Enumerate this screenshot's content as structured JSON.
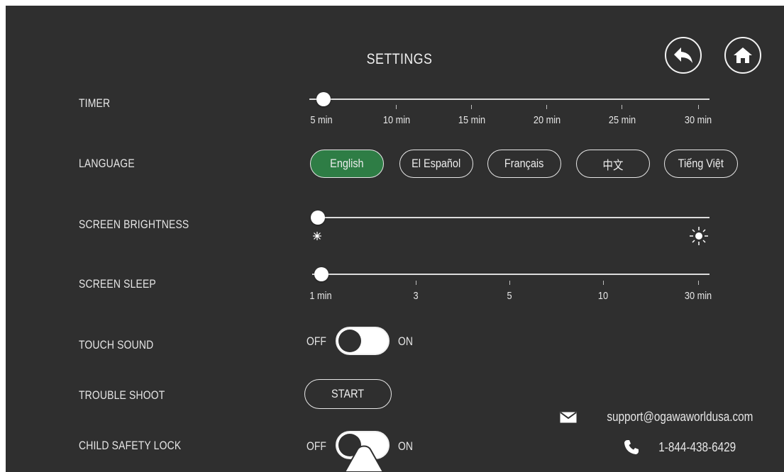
{
  "header": {
    "title": "SETTINGS"
  },
  "rows": {
    "timer": {
      "label": "TIMER",
      "ticks": [
        "5 min",
        "10 min",
        "15 min",
        "20 min",
        "25 min",
        "30 min"
      ],
      "value": "5 min"
    },
    "language": {
      "label": "LANGUAGE",
      "options": [
        "English",
        "El Español",
        "Français",
        "中文",
        "Tiếng Việt"
      ],
      "selected": "English"
    },
    "brightness": {
      "label": "SCREEN BRIGHTNESS",
      "level": 0
    },
    "sleep": {
      "label": "SCREEN SLEEP",
      "ticks": [
        "1 min",
        "3",
        "5",
        "10",
        "30 min"
      ],
      "value": "1 min"
    },
    "touch_sound": {
      "label": "TOUCH SOUND",
      "off": "OFF",
      "on": "ON",
      "state": "OFF"
    },
    "trouble_shoot": {
      "label": "TROUBLE SHOOT",
      "button": "START"
    },
    "child_lock": {
      "label": "CHILD SAFETY LOCK",
      "off": "OFF",
      "on": "ON",
      "state": "OFF"
    }
  },
  "contact": {
    "email": "support@ogawaworldusa.com",
    "phone": "1-844-438-6429"
  },
  "icons": {
    "back": "back-arrow-icon",
    "home": "home-icon",
    "brightness_low": "sun-low-icon",
    "brightness_high": "sun-high-icon",
    "email": "envelope-icon",
    "phone": "phone-icon"
  },
  "colors": {
    "background": "#2f2f2f",
    "accent": "#2e7d45",
    "text": "#e6e6e6"
  }
}
